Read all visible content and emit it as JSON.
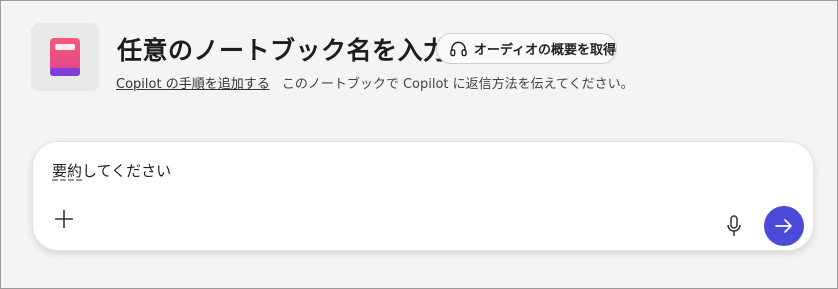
{
  "header": {
    "title": "任意のノートブック名を入力",
    "audio_button_label": "オーディオの概要を取得",
    "copilot_link": "Copilot の手順を追加する",
    "description": "このノートブックで Copilot に返信方法を伝えてください。"
  },
  "chat": {
    "input_text_underlined": "要約",
    "input_text_rest": "してください"
  },
  "icons": {
    "notebook": "notebook-icon",
    "audio": "headphones-icon",
    "add": "plus-icon",
    "mic": "microphone-icon",
    "send": "arrow-right-icon"
  },
  "colors": {
    "send_button": "#4c4ad8",
    "notebook_gradient_top": "#f5587a",
    "notebook_gradient_bottom": "#8b48d9"
  }
}
